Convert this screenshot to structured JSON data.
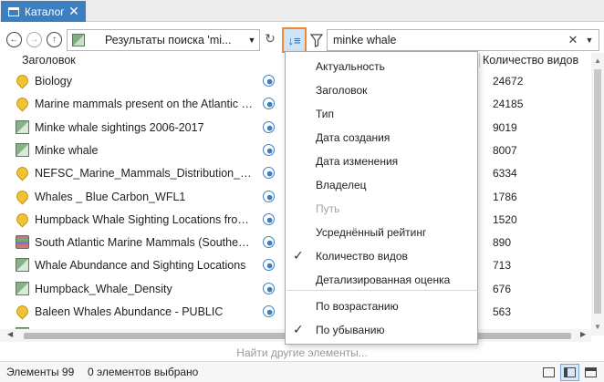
{
  "window": {
    "tab_title": "Каталог"
  },
  "toolbar": {
    "location_text": "Результаты поиска 'mi...",
    "search_value": "minke whale",
    "search_placeholder": ""
  },
  "columns": {
    "title": "Заголовок",
    "count": "Количество видов"
  },
  "rows": [
    {
      "title": "Biology",
      "count": "24672",
      "icon": "pin-icon"
    },
    {
      "title": "Marine mammals present on the Atlantic c...",
      "count": "24185",
      "icon": "pin-icon"
    },
    {
      "title": "Minke whale sightings 2006-2017",
      "count": "9019",
      "icon": "map-icon"
    },
    {
      "title": "Minke whale",
      "count": "8007",
      "icon": "map-icon"
    },
    {
      "title": "NEFSC_Marine_Mammals_Distribution_Lay...",
      "count": "6334",
      "icon": "pin-icon"
    },
    {
      "title": "Whales _ Blue Carbon_WFL1",
      "count": "1786",
      "icon": "pin-icon"
    },
    {
      "title": "Humpback Whale Sighting Locations from...",
      "count": "1520",
      "icon": "pin-icon"
    },
    {
      "title": "South Atlantic Marine Mammals (Southeast...",
      "count": "890",
      "icon": "layer-icon"
    },
    {
      "title": "Whale Abundance and Sighting Locations",
      "count": "713",
      "icon": "map-icon"
    },
    {
      "title": "Humpback_Whale_Density",
      "count": "676",
      "icon": "map-icon"
    },
    {
      "title": "Baleen Whales Abundance - PUBLIC",
      "count": "563",
      "icon": "pin-icon"
    }
  ],
  "sort_menu": {
    "items": [
      {
        "label": "Актуальность",
        "checked": false,
        "disabled": false
      },
      {
        "label": "Заголовок",
        "checked": false,
        "disabled": false
      },
      {
        "label": "Тип",
        "checked": false,
        "disabled": false
      },
      {
        "label": "Дата создания",
        "checked": false,
        "disabled": false
      },
      {
        "label": "Дата изменения",
        "checked": false,
        "disabled": false
      },
      {
        "label": "Владелец",
        "checked": false,
        "disabled": false
      },
      {
        "label": "Путь",
        "checked": false,
        "disabled": true
      },
      {
        "label": "Усреднённый рейтинг",
        "checked": false,
        "disabled": false
      },
      {
        "label": "Количество видов",
        "checked": true,
        "disabled": false
      },
      {
        "label": "Детализированная оценка",
        "checked": false,
        "disabled": false
      }
    ],
    "order_items": [
      {
        "label": "По возрастанию",
        "checked": false
      },
      {
        "label": "По убыванию",
        "checked": true
      }
    ]
  },
  "find_more": "Найти другие элементы...",
  "status": {
    "count": "Элементы 99",
    "selected": "0 элементов выбрано"
  },
  "colors": {
    "accent": "#3c7fc1",
    "highlight_border": "#f0883c"
  }
}
